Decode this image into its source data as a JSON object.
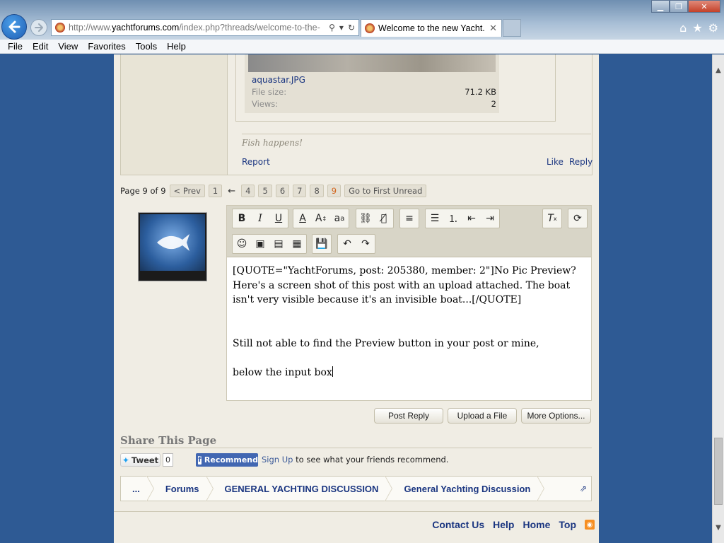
{
  "browser": {
    "url_prefix": "http://www.",
    "url_domain": "yachtforums.com",
    "url_suffix": "/index.php?threads/welcome-to-the-",
    "tab_title": "Welcome to the new Yacht...",
    "tab_close": "✕"
  },
  "menu": [
    "File",
    "Edit",
    "View",
    "Favorites",
    "Tools",
    "Help"
  ],
  "attachment": {
    "name": "aquastar.JPG",
    "file_size_label": "File size:",
    "file_size": "71.2 KB",
    "views_label": "Views:",
    "views": "2"
  },
  "post": {
    "signature": "Fish happens!",
    "report": "Report",
    "like": "Like",
    "reply": "Reply"
  },
  "pagination": {
    "label": "Page 9 of 9",
    "prev": "< Prev",
    "pages_before": [
      "1"
    ],
    "arrow": "←",
    "pages_after": [
      "4",
      "5",
      "6",
      "7",
      "8"
    ],
    "current": "9",
    "first_unread": "Go to First Unread"
  },
  "editor": {
    "lines": [
      "[QUOTE=\"YachtForums, post: 205380, member: 2\"]No Pic Preview? Here's a screen shot of this post with an upload attached. The boat isn't very visible because it's an invisible boat...[/QUOTE]",
      "",
      "",
      "Still not able to find the Preview button in your post or mine,",
      "",
      "below the input box"
    ]
  },
  "buttons": {
    "post_reply": "Post Reply",
    "upload": "Upload a File",
    "more_options": "More Options..."
  },
  "share": {
    "title": "Share This Page",
    "tweet": "Tweet",
    "tweet_count": "0",
    "recommend": "Recommend",
    "sign_up": "Sign Up",
    "sign_up_rest": " to see what your friends recommend."
  },
  "breadcrumb": [
    "...",
    "Forums",
    "GENERAL YACHTING DISCUSSION",
    "General Yachting Discussion"
  ],
  "footer": [
    "Contact Us",
    "Help",
    "Home",
    "Top"
  ]
}
